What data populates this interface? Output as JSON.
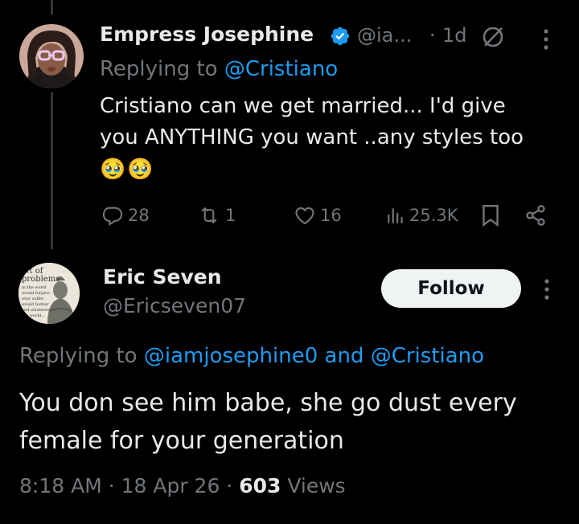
{
  "tweet1": {
    "name": "Empress Josephine",
    "handle": "@ia...",
    "sep": "·",
    "time": "1d",
    "replying_prefix": "Replying to",
    "replying_to": "@Cristiano",
    "text_line1": "Cristiano can we get married... I'd give",
    "text_line2": "you ANYTHING you want ..any styles too",
    "emoji": "🥹🥹",
    "replies": "28",
    "reposts": "1",
    "likes": "16",
    "views": "25.3K"
  },
  "tweet2": {
    "name": "Eric Seven",
    "handle": "@Ericseven07",
    "follow_label": "Follow",
    "replying_prefix": "Replying to",
    "replying_to_1": "@iamjosephine0",
    "replying_and": "and",
    "replying_to_2": "@Cristiano",
    "text_line1": "You don see him babe, she go dust every",
    "text_line2": "female for your generation",
    "time": "8:18 AM · 18 Apr 26 · ",
    "view_count": "603",
    "views_label": " Views",
    "avatar_text": [
      "...t of",
      "problems",
      "in the world",
      "would forgive",
      "ever suffer",
      "would bother",
      "and whatever",
      "the world..."
    ]
  },
  "colors": {
    "accent": "#1d9bf0",
    "muted": "#71767b",
    "text": "#e7e9ea",
    "background": "#000000"
  }
}
